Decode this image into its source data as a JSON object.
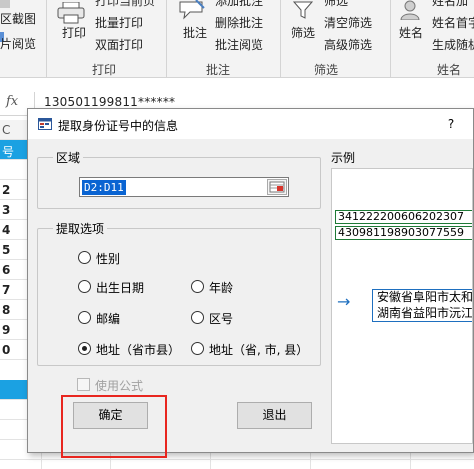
{
  "ribbon": {
    "print_group": {
      "print_label": "打印",
      "batch_print": "批量打印",
      "duplex_print": "双面打印",
      "partial_top": "打印当前页",
      "group_label": "打印"
    },
    "left_partial": {
      "item1": "区截图",
      "item2": "片阅览"
    },
    "comment_group": {
      "comment_label": "批注",
      "add_comment_partial": "添加批注",
      "delete_comment": "删除批注",
      "view_comment": "批注阅览",
      "group_label": "批注"
    },
    "filter_group": {
      "filter_label": "筛选",
      "filter_partial_top": "筛选",
      "clear_filter": "清空筛选",
      "advanced_filter": "高级筛选",
      "group_label": "筛选"
    },
    "name_group": {
      "name_label": "姓名",
      "name_top_partial": "姓名加",
      "name_first_char": "姓名首字",
      "random_generate": "生成随机",
      "group_label": "姓名"
    }
  },
  "formula_bar": {
    "fx": "fx",
    "value": "130501199811******"
  },
  "sheet": {
    "col_header_partial": "C",
    "header_cell": "号",
    "row_values": [
      "2",
      "3",
      "4",
      "5",
      "6",
      "7",
      "8",
      "9",
      "0"
    ]
  },
  "dialog": {
    "title": "提取身份证号中的信息",
    "help": "?",
    "range_group_label": "区域",
    "range_value": "D2:D11",
    "options_group_label": "提取选项",
    "options": [
      {
        "label": "性别",
        "selected": false
      },
      {
        "label": "出生日期",
        "selected": false
      },
      {
        "label": "年龄",
        "selected": false
      },
      {
        "label": "邮编",
        "selected": false
      },
      {
        "label": "区号",
        "selected": false
      },
      {
        "label": "地址（省市县）",
        "selected": true
      },
      {
        "label": "地址（省, 市, 县）",
        "selected": false
      }
    ],
    "use_formula_label": "使用公式",
    "use_formula_checked": false,
    "ok_button": "确定",
    "cancel_button": "退出",
    "example_label": "示例",
    "example_ids": [
      "341222200606202307",
      "430981198903077559"
    ],
    "example_arrow": "→",
    "example_addresses": [
      "安徽省阜阳市太和",
      "湖南省益阳市沅江"
    ]
  },
  "colors": {
    "highlight": "#e8261f",
    "selection_blue": "#0a64d2",
    "header_blue": "#1ba1e2",
    "example_green_border": "#1e7a36",
    "example_blue_border": "#1e6fbf"
  }
}
